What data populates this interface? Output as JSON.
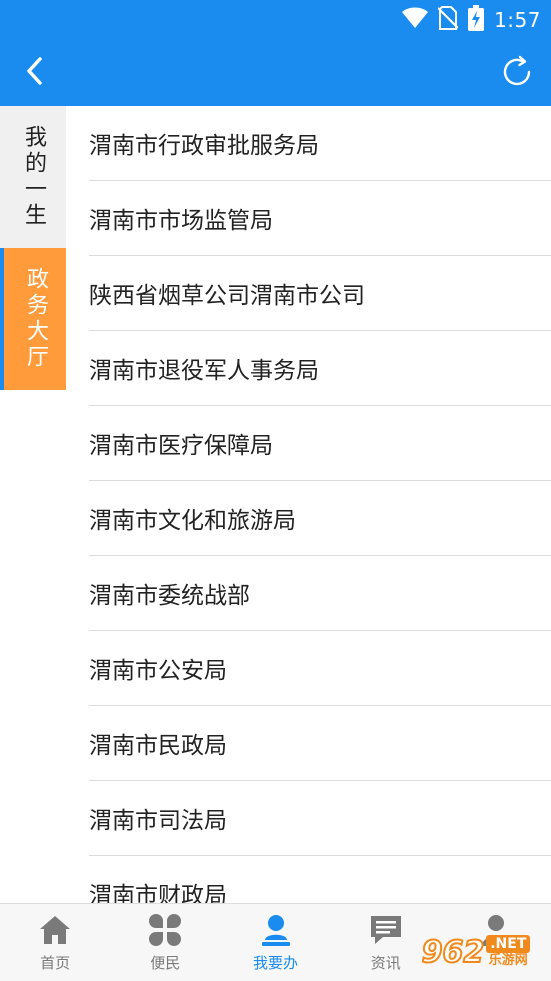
{
  "status_bar": {
    "time": "1:57",
    "icons": [
      "wifi-icon",
      "no-sim-icon",
      "battery-charging-icon"
    ]
  },
  "app_bar": {
    "back_icon": "chevron-left-icon",
    "refresh_icon": "refresh-icon"
  },
  "sidebar": {
    "items": [
      {
        "label": "我的一生",
        "active": false
      },
      {
        "label": "政务大厅",
        "active": true
      }
    ]
  },
  "departments": [
    "渭南市行政审批服务局",
    "渭南市市场监管局",
    "陕西省烟草公司渭南市公司",
    "渭南市退役军人事务局",
    "渭南市医疗保障局",
    "渭南市文化和旅游局",
    "渭南市委统战部",
    "渭南市公安局",
    "渭南市民政局",
    "渭南市司法局",
    "渭南市财政局"
  ],
  "bottom_nav": {
    "tabs": [
      {
        "label": "首页",
        "icon": "home-icon",
        "active": false
      },
      {
        "label": "便民",
        "icon": "clover-icon",
        "active": false
      },
      {
        "label": "我要办",
        "icon": "user-stamp-icon",
        "active": true
      },
      {
        "label": "资讯",
        "icon": "message-icon",
        "active": false
      },
      {
        "label": "",
        "icon": "person-icon",
        "active": false
      }
    ]
  },
  "watermark": {
    "number": "962",
    "net": ".NET",
    "sub": "乐游网"
  },
  "colors": {
    "primary": "#1a8cf0",
    "sidebar_active": "#ff9b3a",
    "sidebar_inactive": "#f0f0f0",
    "nav_inactive": "#7a7a7a"
  }
}
